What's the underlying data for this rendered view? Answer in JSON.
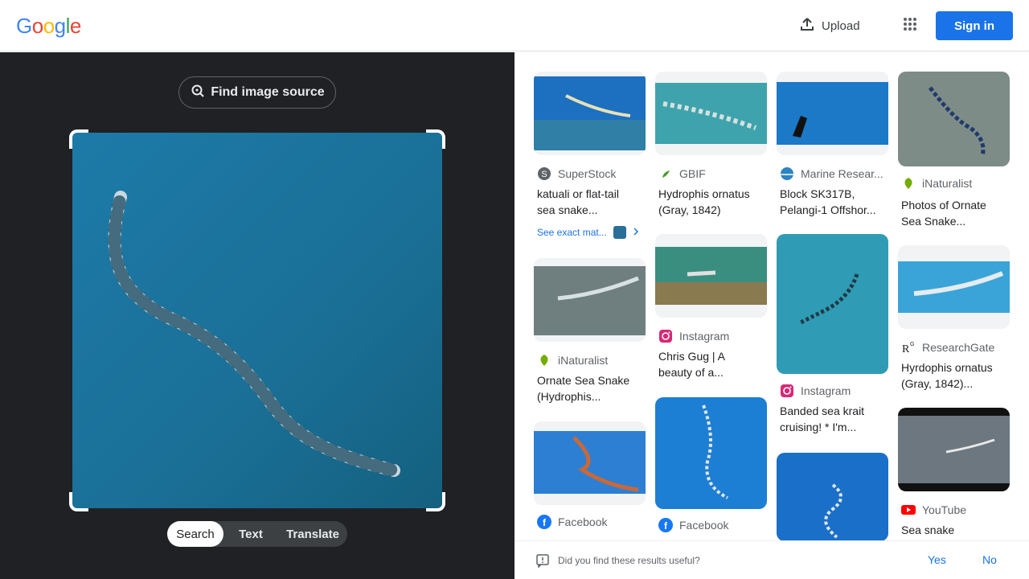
{
  "header": {
    "logo_letters": [
      "G",
      "o",
      "o",
      "g",
      "l",
      "e"
    ],
    "logo_colors": [
      "#4285F4",
      "#EA4335",
      "#FBBC05",
      "#4285F4",
      "#34A853",
      "#EA4335"
    ],
    "upload_label": "Upload",
    "signin_label": "Sign in",
    "apps_icon": "apps-grid-icon"
  },
  "left": {
    "find_source_label": "Find image source",
    "tabs": [
      {
        "label": "Search",
        "active": true
      },
      {
        "label": "Text",
        "active": false
      },
      {
        "label": "Translate",
        "active": false
      }
    ]
  },
  "results": [
    {
      "source": "SuperStock",
      "title_line1": "katuali or flat-tail",
      "title_line2": "sea snake...",
      "exact": "See exact mat..."
    },
    {
      "source": "GBIF",
      "title_line1": "Hydrophis ornatus",
      "title_line2": "(Gray, 1842)"
    },
    {
      "source": "Marine Resear...",
      "title_line1": "Block SK317B,",
      "title_line2": "Pelangi-1 Offshor..."
    },
    {
      "source": "iNaturalist",
      "title_line1": "Photos of Ornate",
      "title_line2": "Sea Snake..."
    },
    {
      "source": "iNaturalist",
      "title_line1": "Ornate Sea Snake",
      "title_line2": "(Hydrophis..."
    },
    {
      "source": "Instagram",
      "title_line1": "Chris Gug | A",
      "title_line2": "beauty of a..."
    },
    {
      "source": "Instagram",
      "title_line1": "Banded sea krait",
      "title_line2": "cruising! * I'm..."
    },
    {
      "source": "ResearchGate",
      "title_line1": "Hyrdophis ornatus",
      "title_line2": "(Gray, 1842)..."
    },
    {
      "source": "Facebook",
      "title_line1": "",
      "title_line2": ""
    },
    {
      "source": "Facebook",
      "title_line1": "",
      "title_line2": ""
    },
    {
      "source": "YouTube",
      "title_line1": "Sea snake",
      "title_line2": ""
    }
  ],
  "feedback": {
    "question": "Did you find these results useful?",
    "yes": "Yes",
    "no": "No"
  },
  "colors": {
    "accent": "#1a73e8",
    "dark_bg": "#202124"
  }
}
